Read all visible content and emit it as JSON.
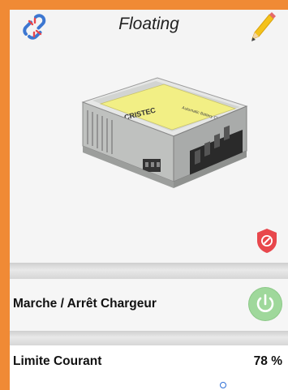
{
  "header": {
    "title": "Floating",
    "left_icon": "unlink-icon",
    "right_icon": "pencil-edit-icon"
  },
  "product": {
    "brand": "CRISTEC",
    "label": "Automatic Battery Charger",
    "stop_icon": "stop-badge-icon"
  },
  "charger_toggle": {
    "label": "Marche / Arrêt Chargeur",
    "icon": "power-icon",
    "state_color": "#9fd89b"
  },
  "current_limit": {
    "label": "Limite Courant",
    "value": "78 %",
    "level_percent": 78
  },
  "colors": {
    "frame": "#f08a35",
    "accent_blue": "#2f6fd6",
    "stop_red": "#e8474c"
  }
}
